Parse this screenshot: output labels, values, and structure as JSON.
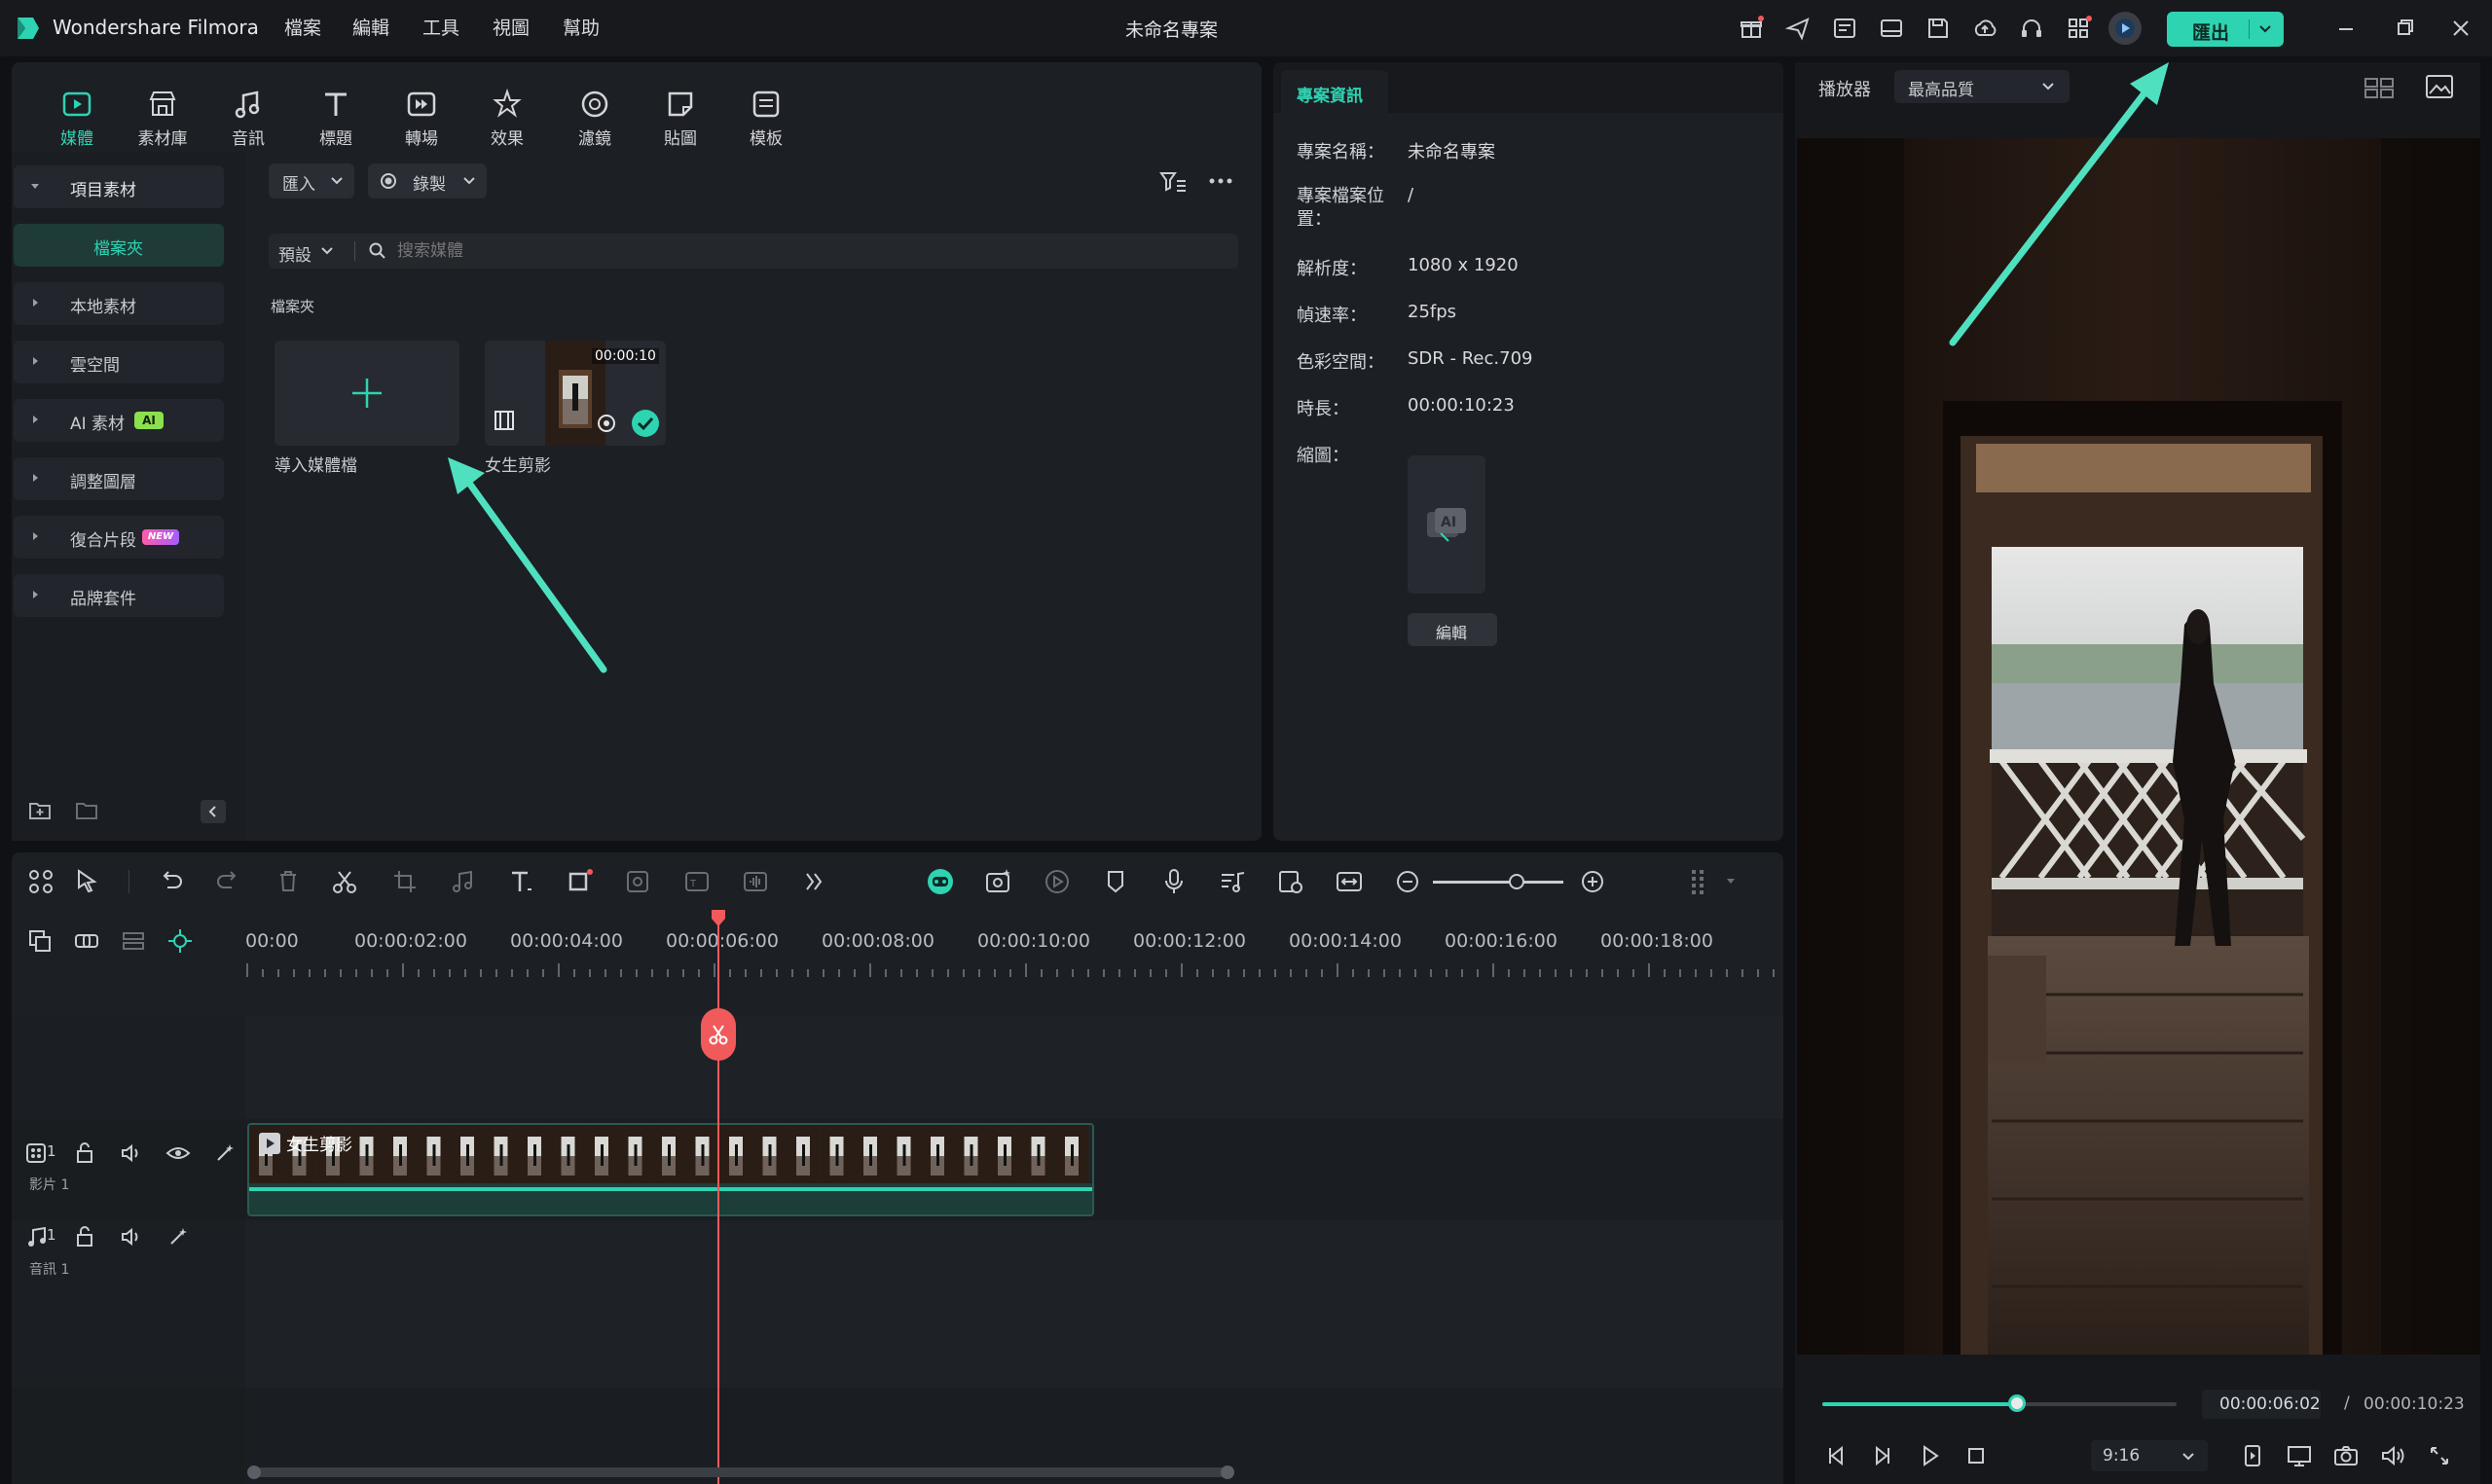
{
  "app": {
    "name": "Wondershare Filmora",
    "project_title": "未命名專案",
    "menu": [
      "檔案",
      "編輯",
      "工具",
      "視圖",
      "幫助"
    ],
    "export_label": "匯出",
    "accent": "#2ed3b2"
  },
  "media_tabs": [
    "媒體",
    "素材庫",
    "音訊",
    "標題",
    "轉場",
    "效果",
    "濾鏡",
    "貼圖",
    "模板"
  ],
  "sidebar": {
    "items": [
      "項目素材",
      "檔案夾",
      "本地素材",
      "雲空間",
      "AI 素材",
      "調整圖層",
      "復合片段",
      "品牌套件"
    ],
    "badges": {
      "ai": "AI",
      "new": "NEW"
    }
  },
  "media_panel": {
    "import_label": "匯入",
    "record_label": "錄製",
    "sort_label": "預設",
    "search_placeholder": "搜索媒體",
    "folder_label": "檔案夾",
    "import_tile_label": "導入媒體檔",
    "clip": {
      "name": "女生剪影",
      "duration": "00:00:10"
    }
  },
  "project_info": {
    "tab": "專案資訊",
    "fields": [
      {
        "label": "專案名稱：",
        "value": "未命名專案"
      },
      {
        "label": "專案檔案位置：",
        "value": "/"
      },
      {
        "label": "解析度：",
        "value": "1080 x 1920"
      },
      {
        "label": "幀速率：",
        "value": "25fps"
      },
      {
        "label": "色彩空間：",
        "value": "SDR - Rec.709"
      },
      {
        "label": "時長：",
        "value": "00:00:10:23"
      },
      {
        "label": "縮圖：",
        "value": ""
      }
    ],
    "edit_button": "編輯"
  },
  "player": {
    "label": "播放器",
    "quality": "最高品質",
    "current_time": "00:00:06:02",
    "separator": "/",
    "total_time": "00:00:10:23",
    "aspect": "9:16",
    "progress": 0.55
  },
  "timeline": {
    "ruler": [
      "00:00",
      "00:00:02:00",
      "00:00:04:00",
      "00:00:06:00",
      "00:00:08:00",
      "00:00:10:00",
      "00:00:12:00",
      "00:00:14:00",
      "00:00:16:00",
      "00:00:18:00"
    ],
    "video_track": {
      "index": "1",
      "name": "影片 1",
      "clip_name": "女生剪影"
    },
    "audio_track": {
      "index": "1",
      "name": "音訊 1"
    },
    "playhead_color": "#f05a5a"
  }
}
